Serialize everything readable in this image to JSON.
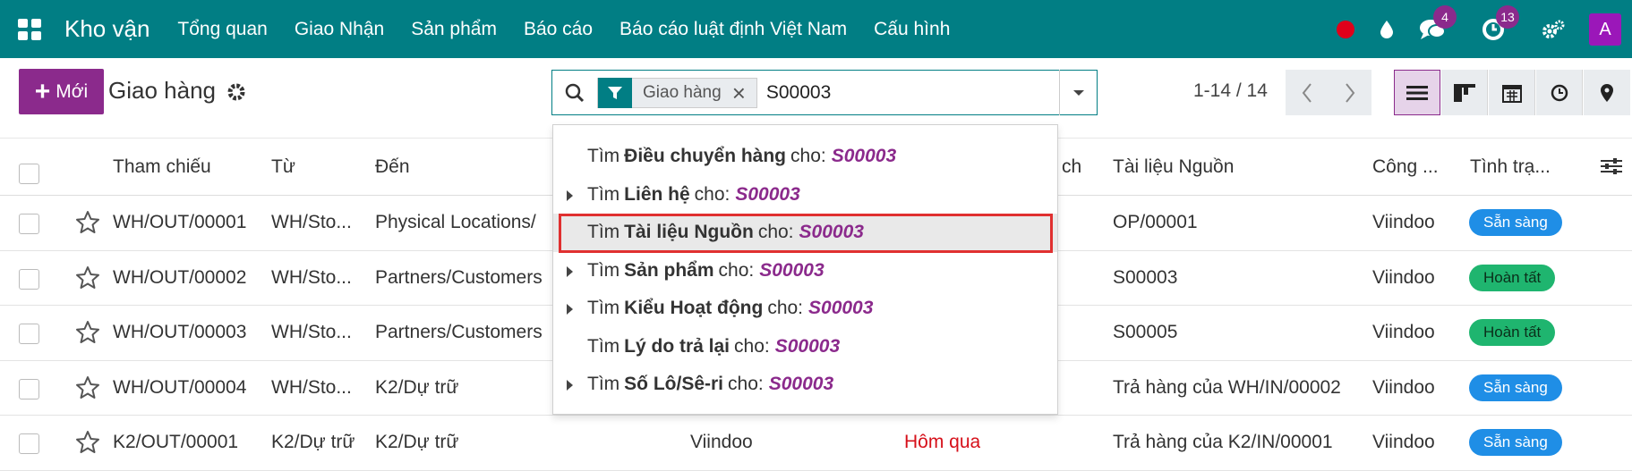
{
  "navbar": {
    "app_title": "Kho vận",
    "menu": [
      "Tổng quan",
      "Giao Nhận",
      "Sản phẩm",
      "Báo cáo",
      "Báo cáo luật định Việt Nam",
      "Cấu hình"
    ],
    "messages_count": "4",
    "activities_count": "13",
    "avatar_letter": "A"
  },
  "control": {
    "new_label": "Mới",
    "page_title": "Giao hàng",
    "facet_label": "Giao hàng",
    "search_value": "S00003",
    "pager": "1-14 / 14"
  },
  "table": {
    "headers": {
      "reference": "Tham chiếu",
      "from": "Từ",
      "to": "Đến",
      "schedule_partial": "ch",
      "source_doc": "Tài liệu Nguồn",
      "company": "Công ...",
      "status": "Tình trạ..."
    },
    "rows": [
      {
        "ref": "WH/OUT/00001",
        "from": "WH/Sto...",
        "to": "Physical Locations/",
        "contact": "",
        "date": "",
        "source": "OP/00001",
        "company": "Viindoo",
        "status": "Sẵn sàng",
        "status_type": "ready"
      },
      {
        "ref": "WH/OUT/00002",
        "from": "WH/Sto...",
        "to": "Partners/Customers",
        "contact": "",
        "date": "",
        "source": "S00003",
        "company": "Viindoo",
        "status": "Hoàn tất",
        "status_type": "done"
      },
      {
        "ref": "WH/OUT/00003",
        "from": "WH/Sto...",
        "to": "Partners/Customers",
        "contact": "",
        "date": "",
        "source": "S00005",
        "company": "Viindoo",
        "status": "Hoàn tất",
        "status_type": "done"
      },
      {
        "ref": "WH/OUT/00004",
        "from": "WH/Sto...",
        "to": "K2/Dự trữ",
        "contact": "",
        "date": "",
        "source": "Trả hàng của WH/IN/00002",
        "company": "Viindoo",
        "status": "Sẵn sàng",
        "status_type": "ready"
      },
      {
        "ref": "K2/OUT/00001",
        "from": "K2/Dự trữ",
        "to": "K2/Dự trữ",
        "contact": "Viindoo",
        "date": "Hôm qua",
        "source": "Trả hàng của K2/IN/00001",
        "company": "Viindoo",
        "status": "Sẵn sàng",
        "status_type": "ready"
      }
    ]
  },
  "dropdown": {
    "prefix": "Tìm",
    "joiner": "cho:",
    "query": "S00003",
    "items": [
      {
        "field": "Điều chuyển hàng",
        "expandable": false
      },
      {
        "field": "Liên hệ",
        "expandable": true
      },
      {
        "field": "Tài liệu Nguồn",
        "expandable": false,
        "highlighted": true
      },
      {
        "field": "Sản phẩm",
        "expandable": true
      },
      {
        "field": "Kiểu Hoạt động",
        "expandable": true
      },
      {
        "field": "Lý do trả lại",
        "expandable": false
      },
      {
        "field": "Số Lô/Sê-ri",
        "expandable": true
      }
    ]
  },
  "colors": {
    "navbar": "#017e84",
    "primary": "#8b2a8c",
    "ready": "#1f8ee6",
    "done": "#1fb56f",
    "late": "#d6101a",
    "highlight_border": "#e03030"
  }
}
